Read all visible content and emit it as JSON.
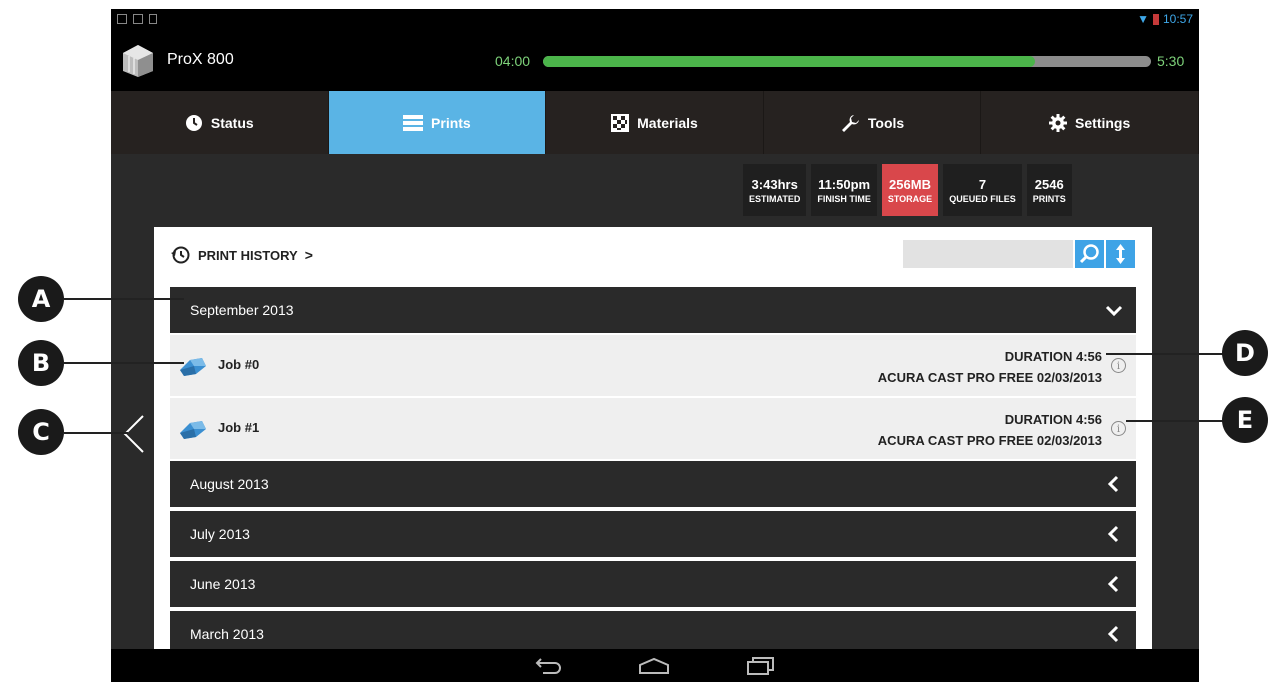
{
  "status_bar": {
    "time": "10:57"
  },
  "header": {
    "app_title": "ProX 800",
    "elapsed": "04:00",
    "total": "5:30",
    "progress_percent": 81
  },
  "tabs": [
    {
      "label": "Status",
      "icon": "clock-icon",
      "active": false
    },
    {
      "label": "Prints",
      "icon": "list-icon",
      "active": true
    },
    {
      "label": "Materials",
      "icon": "checker-icon",
      "active": false
    },
    {
      "label": "Tools",
      "icon": "wrench-icon",
      "active": false
    },
    {
      "label": "Settings",
      "icon": "gear-icon",
      "active": false
    }
  ],
  "stats": [
    {
      "value": "3:43hrs",
      "label": "ESTIMATED"
    },
    {
      "value": "11:50pm",
      "label": "FINISH TIME"
    },
    {
      "value": "256MB",
      "label": "STORAGE",
      "highlight": "#d9474b"
    },
    {
      "value": "7",
      "label": "QUEUED FILES"
    },
    {
      "value": "2546",
      "label": "PRINTS"
    }
  ],
  "print_history": {
    "title": "PRINT HISTORY",
    "search_placeholder": "",
    "months": [
      {
        "label": "September 2013",
        "expanded": true
      },
      {
        "label": "August 2013",
        "expanded": false
      },
      {
        "label": "July 2013",
        "expanded": false
      },
      {
        "label": "June 2013",
        "expanded": false
      },
      {
        "label": "March 2013",
        "expanded": false
      }
    ],
    "jobs": [
      {
        "name": "Job #0",
        "duration": "DURATION 4:56",
        "material": "ACURA CAST PRO FREE  02/03/2013"
      },
      {
        "name": "Job #1",
        "duration": "DURATION 4:56",
        "material": "ACURA CAST PRO FREE  02/03/2013"
      }
    ]
  },
  "callouts": [
    "A",
    "B",
    "C",
    "D",
    "E"
  ],
  "colors": {
    "accent": "#5ab4e5",
    "progress": "#4bb44a",
    "storage_alert": "#d9474b",
    "search": "#3ea3e6"
  }
}
